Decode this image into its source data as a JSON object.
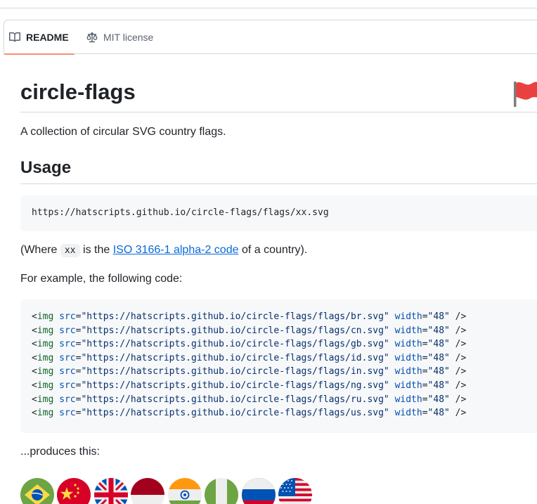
{
  "tabs": [
    {
      "label": "README",
      "icon": "book-icon",
      "active": true
    },
    {
      "label": "MIT license",
      "icon": "law-scale-icon",
      "active": false
    }
  ],
  "readme": {
    "title": "circle-flags",
    "description": "A collection of circular SVG country flags.",
    "usage_heading": "Usage",
    "usage_code": "https://hatscripts.github.io/circle-flags/flags/xx.svg",
    "where_prefix": "(Where ",
    "where_code": "xx",
    "where_mid": " is the ",
    "where_link": "ISO 3166-1 alpha-2 code",
    "where_suffix": " of a country).",
    "example_text": "For example, the following code:",
    "produces_text": "...produces this:",
    "example_lines": [
      {
        "open": "<",
        "tag": "img",
        "src_attr": "src",
        "eq": "=",
        "url": "\"https://hatscripts.github.io/circle-flags/flags/br.svg\"",
        "width_attr": "width",
        "width_val": "\"48\"",
        "close": " />"
      },
      {
        "open": "<",
        "tag": "img",
        "src_attr": "src",
        "eq": "=",
        "url": "\"https://hatscripts.github.io/circle-flags/flags/cn.svg\"",
        "width_attr": "width",
        "width_val": "\"48\"",
        "close": " />"
      },
      {
        "open": "<",
        "tag": "img",
        "src_attr": "src",
        "eq": "=",
        "url": "\"https://hatscripts.github.io/circle-flags/flags/gb.svg\"",
        "width_attr": "width",
        "width_val": "\"48\"",
        "close": " />"
      },
      {
        "open": "<",
        "tag": "img",
        "src_attr": "src",
        "eq": "=",
        "url": "\"https://hatscripts.github.io/circle-flags/flags/id.svg\"",
        "width_attr": "width",
        "width_val": "\"48\"",
        "close": " />"
      },
      {
        "open": "<",
        "tag": "img",
        "src_attr": "src",
        "eq": "=",
        "url": "\"https://hatscripts.github.io/circle-flags/flags/in.svg\"",
        "width_attr": "width",
        "width_val": "\"48\"",
        "close": " />"
      },
      {
        "open": "<",
        "tag": "img",
        "src_attr": "src",
        "eq": "=",
        "url": "\"https://hatscripts.github.io/circle-flags/flags/ng.svg\"",
        "width_attr": "width",
        "width_val": "\"48\"",
        "close": " />"
      },
      {
        "open": "<",
        "tag": "img",
        "src_attr": "src",
        "eq": "=",
        "url": "\"https://hatscripts.github.io/circle-flags/flags/ru.svg\"",
        "width_attr": "width",
        "width_val": "\"48\"",
        "close": " />"
      },
      {
        "open": "<",
        "tag": "img",
        "src_attr": "src",
        "eq": "=",
        "url": "\"https://hatscripts.github.io/circle-flags/flags/us.svg\"",
        "width_attr": "width",
        "width_val": "\"48\"",
        "close": " />"
      }
    ],
    "flag_icons": [
      "brazil-flag-icon",
      "china-flag-icon",
      "united-kingdom-flag-icon",
      "indonesia-flag-icon",
      "india-flag-icon",
      "nigeria-flag-icon",
      "russia-flag-icon",
      "united-states-flag-icon"
    ]
  },
  "icons": {
    "copy": "copy-icon",
    "logo": "red-flag-logo-icon"
  },
  "colors": {
    "accent_underline": "#fd8c73",
    "link": "#0969da",
    "code_bg": "#f6f8fa",
    "border": "#d1d9e0",
    "syntax_tag": "#116329",
    "syntax_attr": "#0550ae",
    "syntax_string": "#0a3069"
  }
}
